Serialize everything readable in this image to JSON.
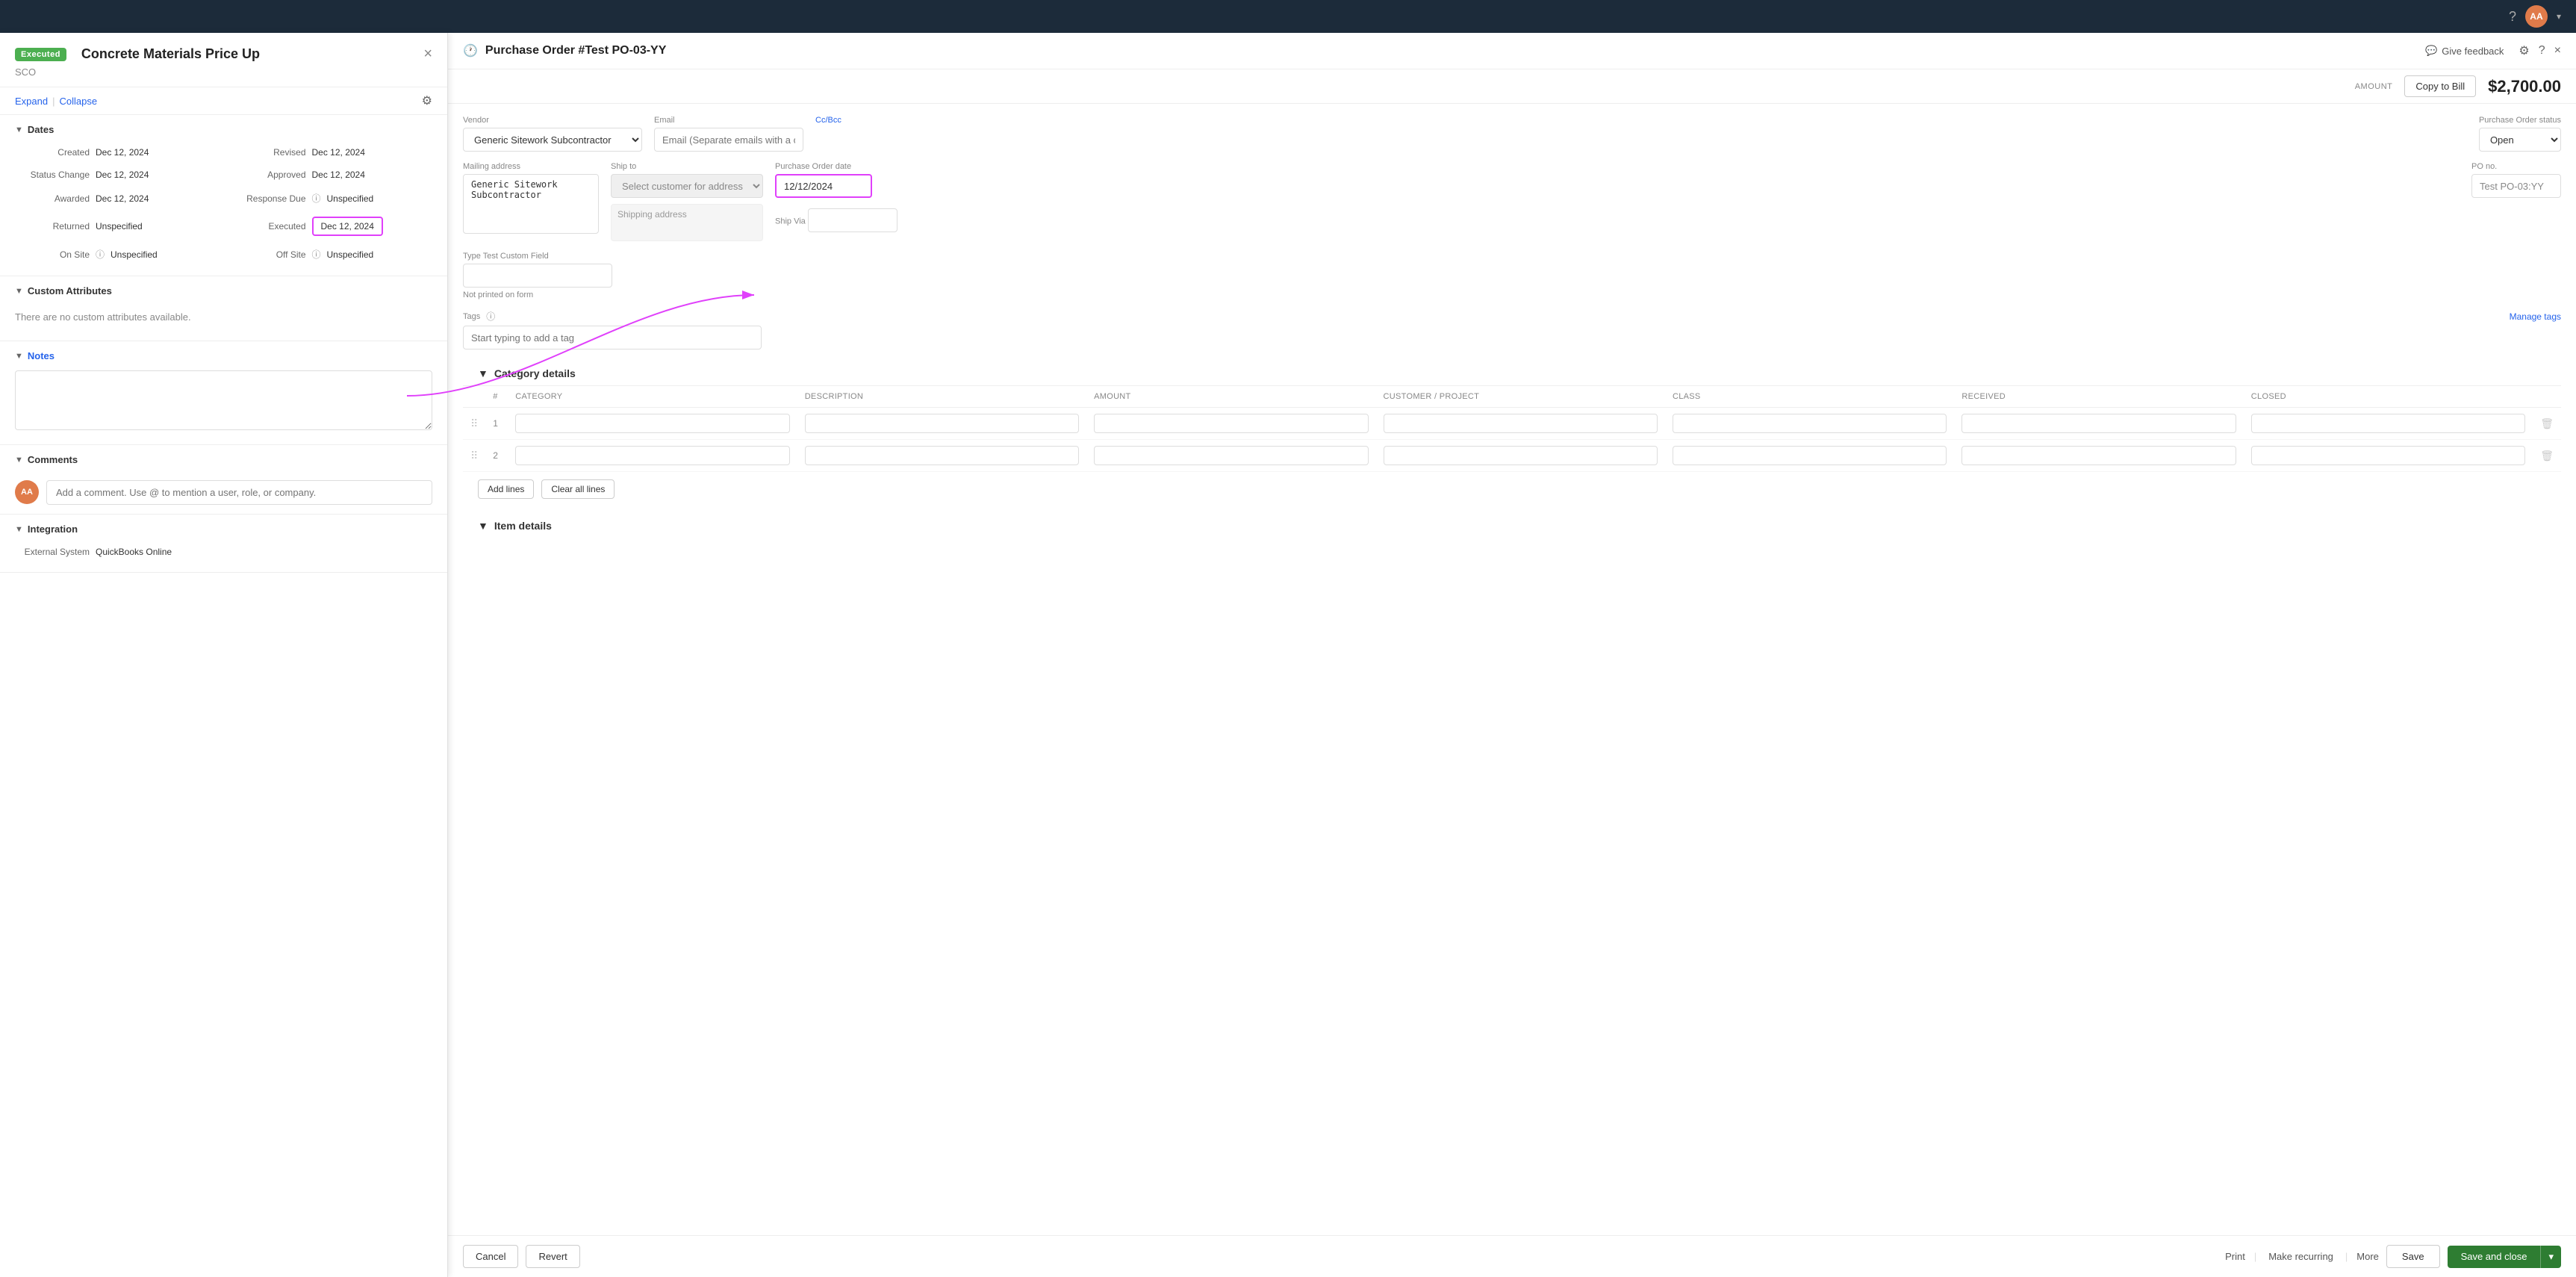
{
  "topbar": {
    "help_icon": "?",
    "avatar_initials": "AA"
  },
  "left_panel": {
    "badge": "Executed",
    "title": "Concrete Materials Price Up",
    "subtitle": "SCO",
    "close_icon": "×",
    "expand_label": "Expand",
    "collapse_label": "Collapse",
    "dates_section": {
      "label": "Dates",
      "items": [
        {
          "label": "Created",
          "value": "Dec 12, 2024"
        },
        {
          "label": "Revised",
          "value": "Dec 12, 2024"
        },
        {
          "label": "Status Change",
          "value": "Dec 12, 2024"
        },
        {
          "label": "Approved",
          "value": "Dec 12, 2024"
        },
        {
          "label": "Awarded",
          "value": "Dec 12, 2024"
        },
        {
          "label": "Response Due",
          "value": "Unspecified",
          "has_info": true
        },
        {
          "label": "Returned",
          "value": "Unspecified"
        },
        {
          "label": "Executed",
          "value": "Dec 12, 2024",
          "highlight": true
        },
        {
          "label": "On Site",
          "value": "Unspecified",
          "has_info": true
        },
        {
          "label": "Off Site",
          "value": "Unspecified",
          "has_info": true
        }
      ]
    },
    "custom_attrs": {
      "label": "Custom Attributes",
      "empty_text": "There are no custom attributes available."
    },
    "notes": {
      "label": "Notes",
      "placeholder": ""
    },
    "comments": {
      "label": "Comments",
      "avatar": "AA",
      "placeholder": "Add a comment. Use @ to mention a user, role, or company."
    },
    "integration": {
      "label": "Integration",
      "external_system_label": "External System",
      "external_system_value": "QuickBooks Online"
    }
  },
  "right_panel": {
    "title": "Purchase Order #Test PO-03-YY",
    "clock_icon": "🕐",
    "give_feedback_label": "Give feedback",
    "gear_icon": "⚙",
    "help_icon": "?",
    "close_icon": "×",
    "amount_label": "AMOUNT",
    "copy_to_bill_label": "Copy to Bill",
    "amount_value": "$2,700.00",
    "vendor_label": "Vendor",
    "vendor_value": "Generic Sitework Subcontractor",
    "email_label": "Email",
    "email_placeholder": "Email (Separate emails with a comma)",
    "cc_bcc_label": "Cc/Bcc",
    "po_status_label": "Purchase Order status",
    "po_status_value": "Open",
    "mailing_address_label": "Mailing address",
    "mailing_address_value": "Generic Sitework Subcontractor",
    "ship_to_label": "Ship to",
    "ship_to_placeholder": "Select customer for address",
    "po_date_label": "Purchase Order date",
    "po_date_value": "12/12/2024",
    "ship_via_label": "Ship Via",
    "ship_via_value": "",
    "po_no_label": "PO no.",
    "po_no_value": "Test PO-03:YY",
    "custom_field_label": "Type Test Custom Field",
    "not_printed_label": "Not printed on form",
    "tags_label": "Tags",
    "manage_tags_label": "Manage tags",
    "tags_placeholder": "Start typing to add a tag",
    "category_details_label": "Category details",
    "category_table": {
      "columns": [
        "#",
        "CATEGORY",
        "DESCRIPTION",
        "AMOUNT",
        "CUSTOMER / PROJECT",
        "CLASS",
        "RECEIVED",
        "CLOSED"
      ],
      "rows": [
        {
          "num": "1"
        },
        {
          "num": "2"
        }
      ],
      "add_lines_label": "Add lines",
      "clear_all_lines_label": "Clear all lines"
    },
    "item_details_label": "Item details",
    "footer": {
      "cancel_label": "Cancel",
      "revert_label": "Revert",
      "print_label": "Print",
      "make_recurring_label": "Make recurring",
      "more_label": "More",
      "save_label": "Save",
      "save_close_label": "Save and close"
    }
  }
}
